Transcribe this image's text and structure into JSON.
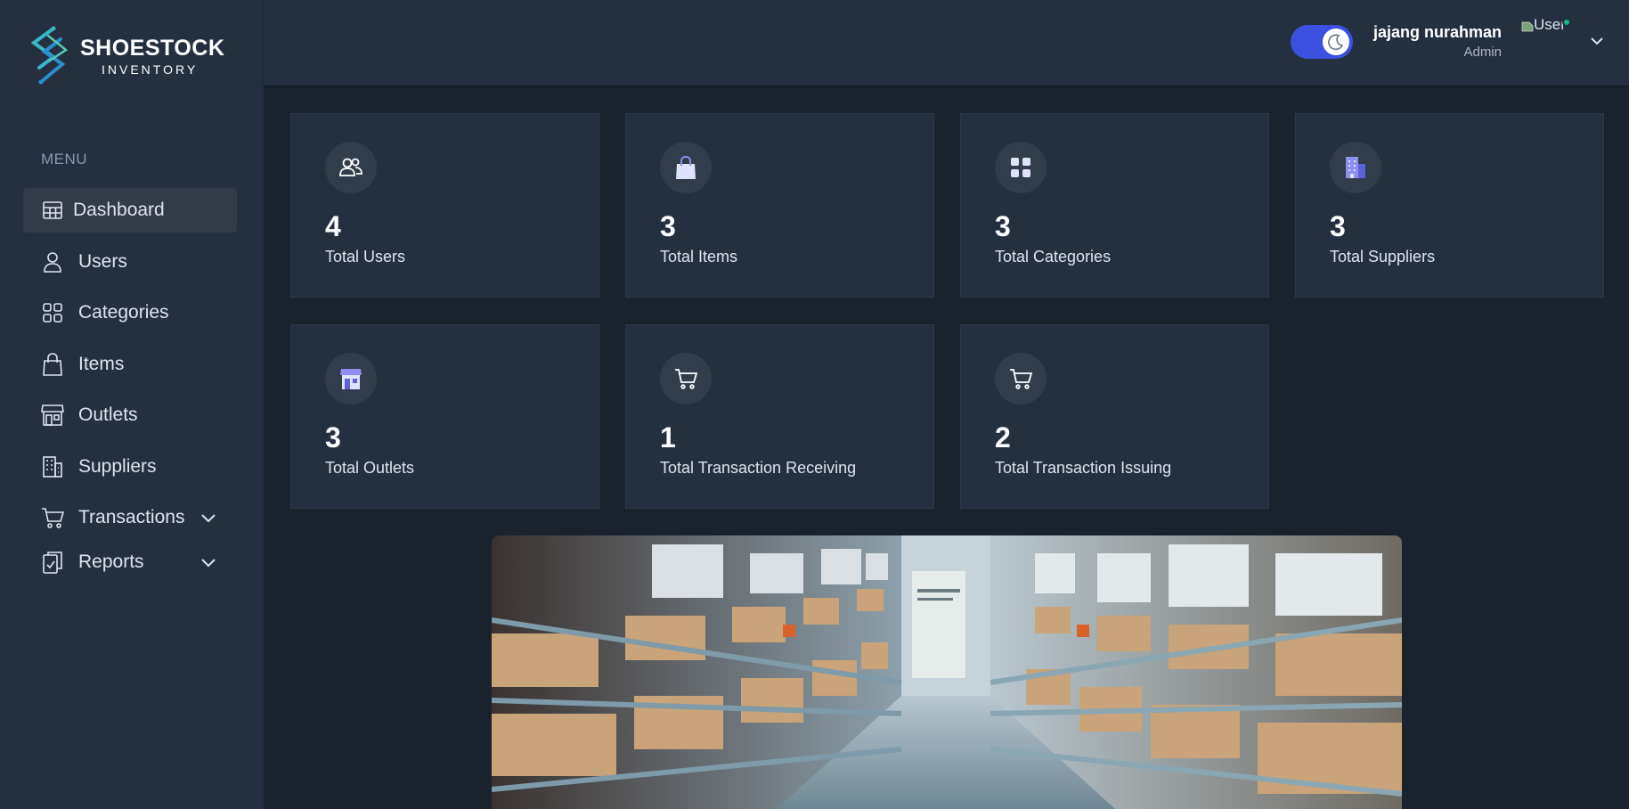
{
  "brand": {
    "title": "SHOESTOCK",
    "subtitle": "INVENTORY"
  },
  "sidebar": {
    "menu_label": "MENU",
    "items": [
      {
        "label": "Dashboard",
        "icon": "table-grid-icon",
        "active": true
      },
      {
        "label": "Users",
        "icon": "user-icon"
      },
      {
        "label": "Categories",
        "icon": "categories-grid-icon"
      },
      {
        "label": "Items",
        "icon": "shopping-bag-icon"
      },
      {
        "label": "Outlets",
        "icon": "store-icon"
      },
      {
        "label": "Suppliers",
        "icon": "building-icon"
      },
      {
        "label": "Transactions",
        "icon": "cart-icon",
        "expandable": true
      },
      {
        "label": "Reports",
        "icon": "clipboard-icon",
        "expandable": true
      }
    ]
  },
  "header": {
    "theme_toggle": {
      "state": "dark",
      "icon": "moon-icon"
    },
    "user": {
      "name": "jajang nurahman",
      "role": "Admin",
      "avatar_alt": "User",
      "online": true
    }
  },
  "stats": [
    {
      "value": "4",
      "label": "Total Users",
      "icon": "users-icon"
    },
    {
      "value": "3",
      "label": "Total Items",
      "icon": "shopping-bag-icon"
    },
    {
      "value": "3",
      "label": "Total Categories",
      "icon": "grid-icon"
    },
    {
      "value": "3",
      "label": "Total Suppliers",
      "icon": "building-icon"
    },
    {
      "value": "3",
      "label": "Total Outlets",
      "icon": "store-icon"
    },
    {
      "value": "1",
      "label": "Total Transaction Receiving",
      "icon": "cart-icon"
    },
    {
      "value": "2",
      "label": "Total Transaction Issuing",
      "icon": "cart-icon"
    }
  ],
  "colors": {
    "sidebar_bg": "#24303f",
    "page_bg": "#1a222d",
    "accent": "#3c50e0",
    "icon_accent": "#8b8ff0",
    "online": "#10b981"
  },
  "banner": {
    "alt": "warehouse-photo"
  }
}
